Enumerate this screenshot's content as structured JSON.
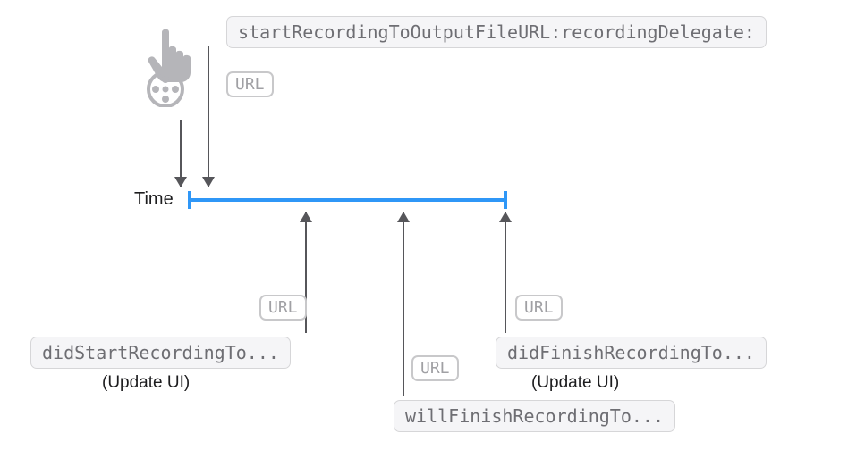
{
  "top_method": "startRecordingToOutputFileURL:recordingDelegate:",
  "time_label": "Time",
  "url_tag": "URL",
  "callbacks": {
    "did_start": "didStartRecordingTo...",
    "will_finish": "willFinishRecordingTo...",
    "did_finish": "didFinishRecordingTo..."
  },
  "notes": {
    "update_ui": "(Update UI)"
  },
  "colors": {
    "timeline": "#2f97f7",
    "box_border": "#d6d6d8",
    "box_bg": "#f5f5f7",
    "text_muted": "#6e6e73",
    "arrow": "#56565a",
    "icon": "#b5b5b9"
  }
}
